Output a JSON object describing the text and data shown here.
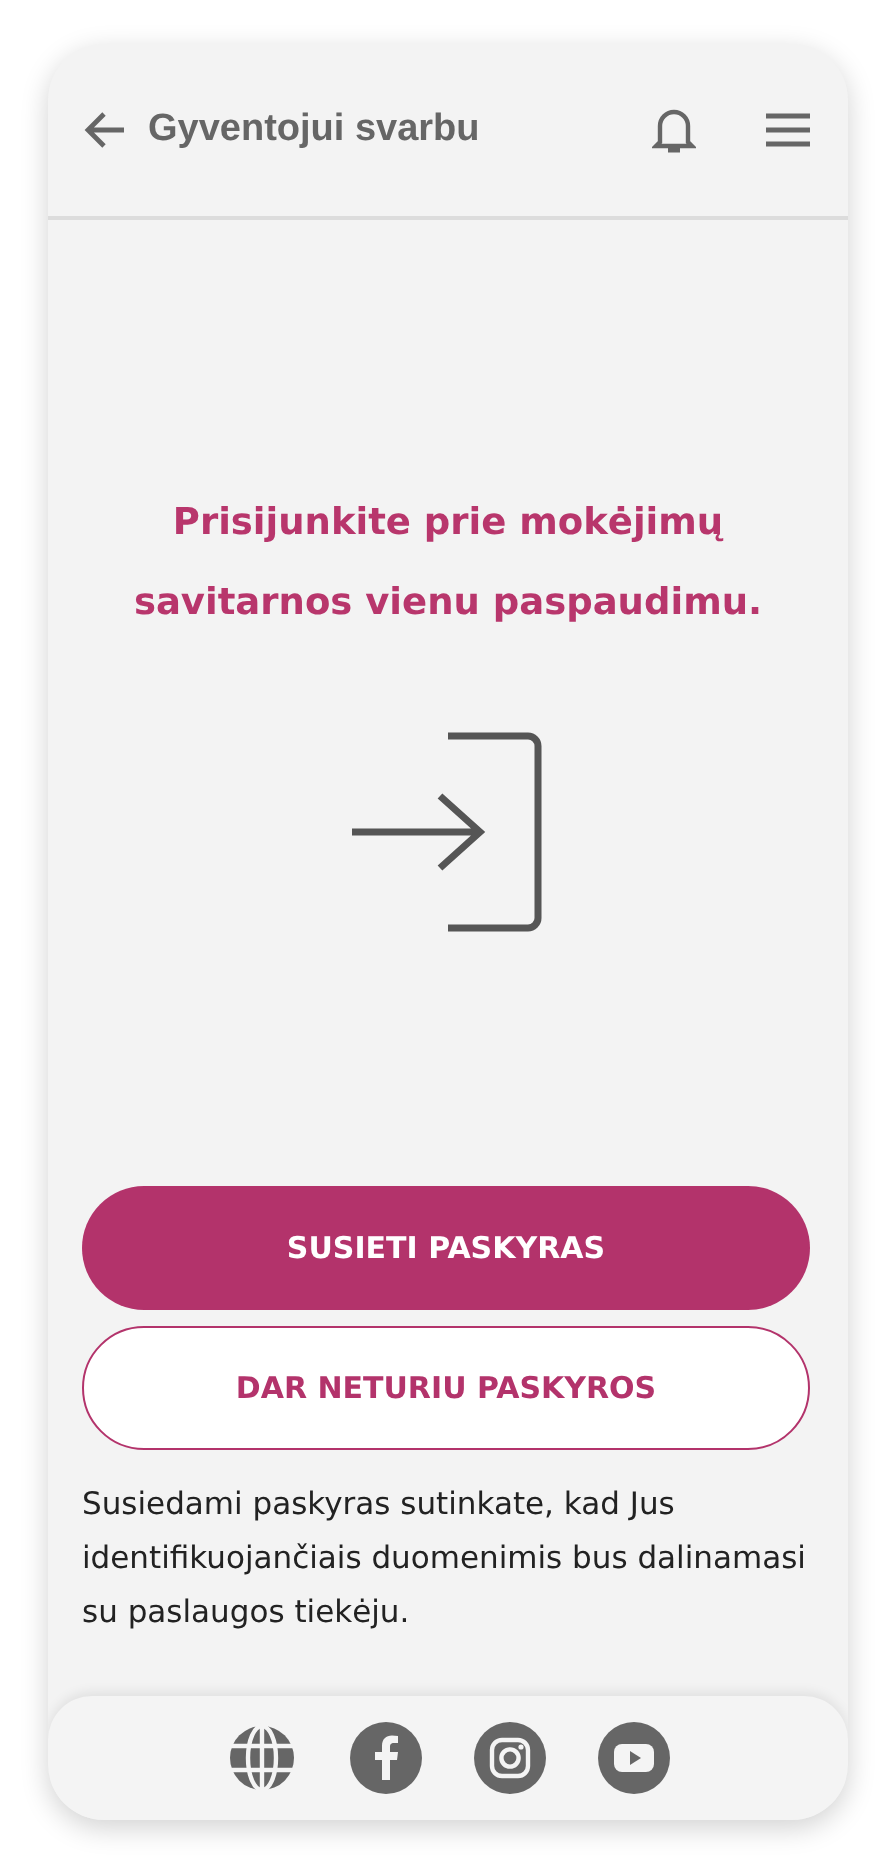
{
  "header": {
    "title": "Gyventojui svarbu"
  },
  "headline": "Prisijunkite prie mokėjimų savitarnos vienu paspaudimu.",
  "buttons": [
    {
      "label": "SUSIETI PASKYRAS",
      "kind": "primary"
    },
    {
      "label": "DAR NETURIU PASKYROS",
      "kind": "outline"
    }
  ],
  "disclaimer": "Susiedami paskyras sutinkate, kad Jus identifikuojančiais duomenimis bus dalinamasi su paslaugos tiekėju."
}
